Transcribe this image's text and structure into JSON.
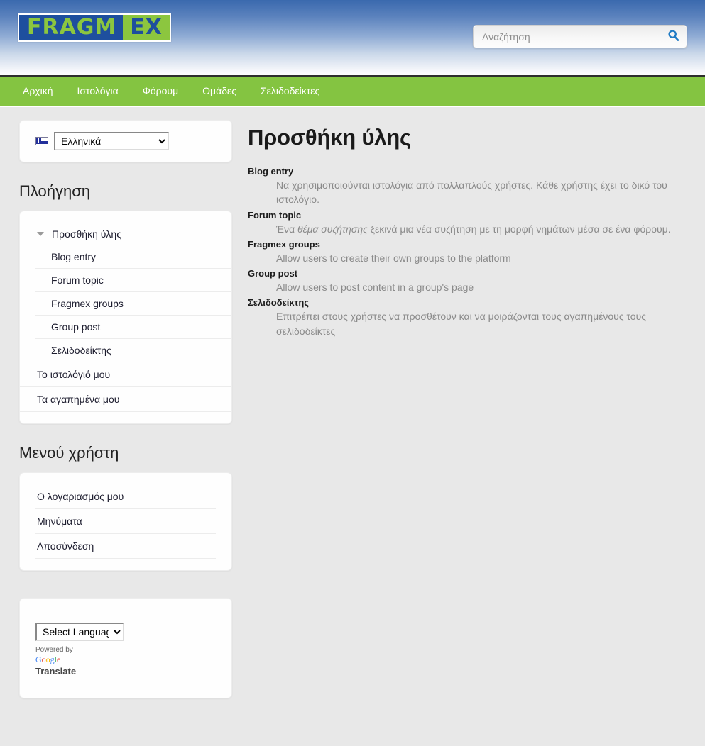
{
  "header": {
    "logo_part1": "FRAGM",
    "logo_part2": "EX",
    "search": {
      "placeholder": "Αναζήτηση",
      "value": "",
      "icon": "search-icon"
    }
  },
  "nav": {
    "items": [
      {
        "label": "Αρχική"
      },
      {
        "label": "Ιστολόγια"
      },
      {
        "label": "Φόρουμ"
      },
      {
        "label": "Ομάδες"
      },
      {
        "label": "Σελιδοδείκτες"
      }
    ]
  },
  "sidebar": {
    "language_block": {
      "flag_icon": "greek-flag-icon",
      "selected": "Ελληνικά",
      "options": [
        "Ελληνικά"
      ]
    },
    "navigation": {
      "title": "Πλοήγηση",
      "expander_icon": "caret-down-icon",
      "group_label": "Προσθήκη ύλης",
      "group_items": [
        {
          "label": "Blog entry"
        },
        {
          "label": "Forum topic"
        },
        {
          "label": "Fragmex groups"
        },
        {
          "label": "Group post"
        },
        {
          "label": "Σελιδοδείκτης"
        }
      ],
      "top_items": [
        {
          "label": "Το ιστολόγιό μου"
        },
        {
          "label": "Τα αγαπημένα μου"
        }
      ]
    },
    "user_menu": {
      "title": "Μενού χρήστη",
      "items": [
        {
          "label": "Ο λογαριασμός μου"
        },
        {
          "label": "Μηνύματα"
        },
        {
          "label": "Αποσύνδεση"
        }
      ]
    },
    "translate": {
      "selected": "Select Language",
      "options": [
        "Select Language"
      ],
      "powered_by": "Powered by",
      "google_letters": [
        "G",
        "o",
        "o",
        "g",
        "l",
        "e"
      ],
      "translate_label": "Translate"
    }
  },
  "main": {
    "title": "Προσθήκη ύλης",
    "entries": [
      {
        "term": "Blog entry",
        "desc_pre": "Να χρησιμοποιούνται ιστολόγια από πολλαπλούς χρήστες. Κάθε χρήστης έχει το δικό του ιστολόγιο.",
        "desc_em": "",
        "desc_post": ""
      },
      {
        "term": "Forum topic",
        "desc_pre": "Ένα ",
        "desc_em": "θέμα συζήτησης",
        "desc_post": " ξεκινά μια νέα συζήτηση με τη μορφή νημάτων μέσα σε ένα φόρουμ."
      },
      {
        "term": "Fragmex groups",
        "desc_pre": "Allow users to create their own groups to the platform",
        "desc_em": "",
        "desc_post": ""
      },
      {
        "term": "Group post",
        "desc_pre": "Allow users to post content in a group's page",
        "desc_em": "",
        "desc_post": ""
      },
      {
        "term": "Σελιδοδείκτης",
        "desc_pre": "Επιτρέπει στους χρήστες να προσθέτουν και να μοιράζονται τους αγαπημένους τους σελιδοδείκτες",
        "desc_em": "",
        "desc_post": ""
      }
    ]
  },
  "colors": {
    "nav_green": "#84c441",
    "header_blue": "#3a69ae",
    "logo_blue": "#1e4f9e",
    "logo_green": "#8cc63f",
    "page_background": "#e8e8e8",
    "search_icon_blue": "#1f7ac4"
  }
}
